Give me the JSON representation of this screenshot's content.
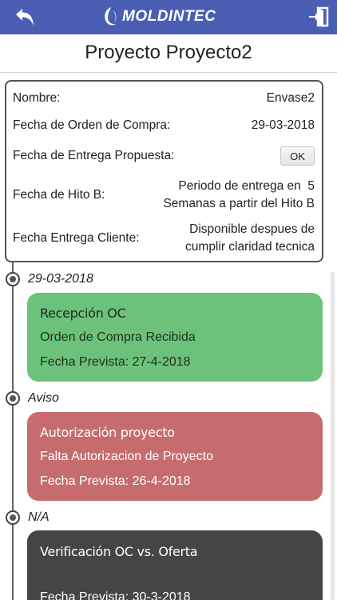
{
  "header": {
    "brand": "MOLDINTEC",
    "back_icon": "back-arrow-icon",
    "exit_icon": "exit-icon",
    "accent_color": "#4a5fb4"
  },
  "page": {
    "title": "Proyecto Proyecto2"
  },
  "info": {
    "nombre_label": "Nombre:",
    "nombre_value": "Envase2",
    "orden_label": "Fecha de Orden de Compra:",
    "orden_value": "29-03-2018",
    "entrega_propuesta_label": "Fecha de Entrega Propuesta:",
    "entrega_propuesta_button": "OK",
    "hito_label": "Fecha de Hito B:",
    "hito_value_line1": "Periodo de entrega en  5",
    "hito_value_line2": "Semanas a partir del Hito B",
    "cliente_label": "Fecha Entrega Cliente:",
    "cliente_value_line1": "Disponible despues de",
    "cliente_value_line2": "cumplir claridad tecnica"
  },
  "timeline": [
    {
      "label": "29-03-2018",
      "title": "Recepción OC",
      "description": "Orden de Compra Recibida",
      "date": "Fecha Prevista: 27-4-2018",
      "color": "#6cc27a"
    },
    {
      "label": "Aviso",
      "title": "Autorización proyecto",
      "description": "Falta Autorizacion de Proyecto",
      "date": "Fecha Prevista: 26-4-2018",
      "color": "#c66c6e"
    },
    {
      "label": "N/A",
      "title": "Verificación OC vs. Oferta",
      "description": "",
      "date": "Fecha Prevista: 30-3-2018",
      "color": "#454545"
    }
  ]
}
